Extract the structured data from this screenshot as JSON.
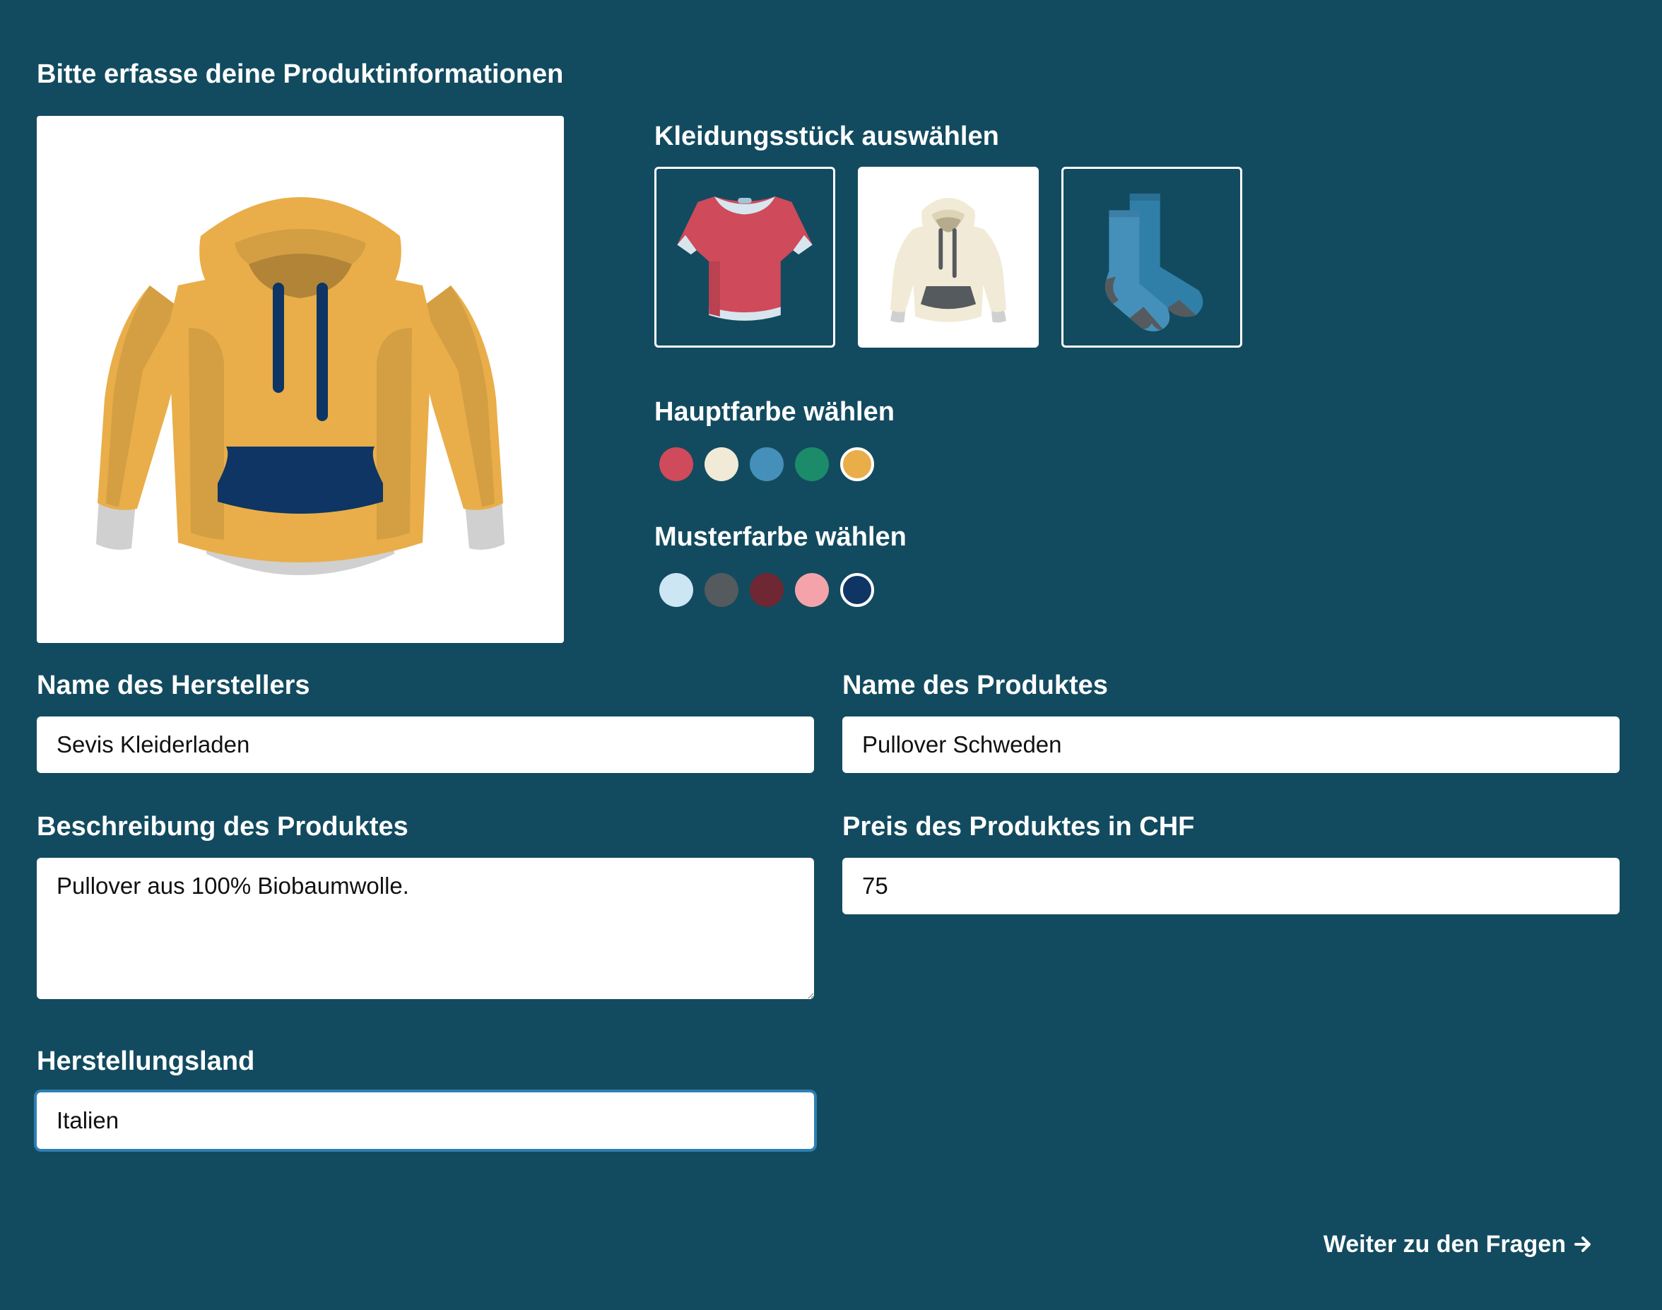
{
  "page": {
    "title": "Bitte erfasse deine Produktinformationen"
  },
  "garment_picker": {
    "label": "Kleidungsstück auswählen",
    "options": [
      {
        "name": "tshirt-icon",
        "selected": false
      },
      {
        "name": "hoodie-icon",
        "selected": true
      },
      {
        "name": "socks-icon",
        "selected": false
      }
    ]
  },
  "main_color": {
    "label": "Hauptfarbe wählen",
    "swatches": [
      "#cf4a5a",
      "#f1ead6",
      "#4590ba",
      "#1c8b6a",
      "#e9ae49"
    ],
    "selected_index": 4
  },
  "pattern_color": {
    "label": "Musterfarbe wählen",
    "swatches": [
      "#cce6f4",
      "#555a5e",
      "#6e2733",
      "#f5a3ab",
      "#0e3563"
    ],
    "selected_index": 4
  },
  "form": {
    "manufacturer": {
      "label": "Name des Herstellers",
      "value": "Sevis Kleiderladen"
    },
    "product_name": {
      "label": "Name des Produktes",
      "value": "Pullover Schweden"
    },
    "description": {
      "label": "Beschreibung des Produktes",
      "value": "Pullover aus 100% Biobaumwolle."
    },
    "price": {
      "label": "Preis des Produktes in CHF",
      "value": "75"
    },
    "country": {
      "label": "Herstellungsland",
      "value": "Italien"
    }
  },
  "next_button": {
    "label": "Weiter zu den Fragen",
    "icon": "arrow-right-icon"
  },
  "colors": {
    "background": "#124b5f",
    "hoodie_main": "#e9ae49",
    "hoodie_pattern": "#0e3563",
    "focus_ring": "#2f7fb4"
  }
}
